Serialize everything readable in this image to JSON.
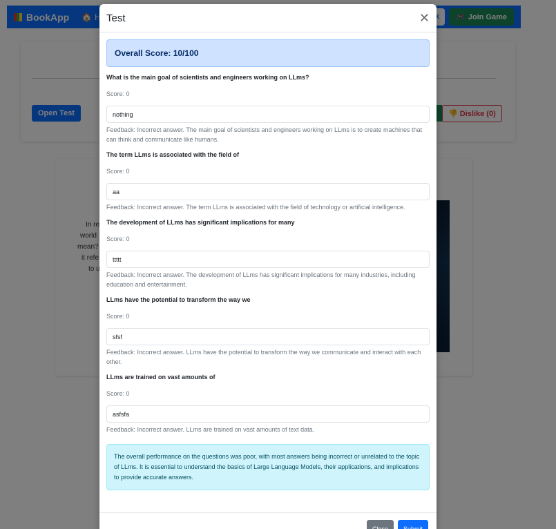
{
  "app": {
    "brand": "BookApp",
    "nav_home": "Home",
    "nav_book": "Book",
    "nav_join_game": "Join Game"
  },
  "background": {
    "open_test": "Open Test",
    "dislike": "Dislike (0)",
    "snippet_lines": [
      "In re",
      "world",
      "mean?",
      "it refe",
      "to u"
    ]
  },
  "modal": {
    "title": "Test",
    "overall_score": "Overall Score: 10/100",
    "questions": [
      {
        "question": "What is the main goal of scientists and engineers working on LLms?",
        "score": "Score: 0",
        "answer": "nothing",
        "feedback": "Feedback: Incorrect answer. The main goal of scientists and engineers working on LLms is to create machines that can think and communicate like humans."
      },
      {
        "question": "The term LLms is associated with the field of",
        "score": "Score: 0",
        "answer": "aa",
        "feedback": "Feedback: Incorrect answer. The term LLms is associated with the field of technology or artificial intelligence."
      },
      {
        "question": "The development of LLms has significant implications for many",
        "score": "Score: 0",
        "answer": "ttttt",
        "feedback": "Feedback: Incorrect answer. The development of LLms has significant implications for many industries, including education and entertainment."
      },
      {
        "question": "LLms have the potential to transform the way we",
        "score": "Score: 0",
        "answer": "sfsf",
        "feedback": "Feedback: Incorrect answer. LLms have the potential to transform the way we communicate and interact with each other."
      },
      {
        "question": "LLms are trained on vast amounts of",
        "score": "Score: 0",
        "answer": "asfsfa",
        "feedback": "Feedback: Incorrect answer. LLms are trained on vast amounts of text data."
      }
    ],
    "summary": "The overall performance on the questions was poor, with most answers being incorrect or unrelated to the topic of LLms. It is essential to understand the basics of Large Language Models, their applications, and implications to provide accurate answers.",
    "close_label": "Close",
    "submit_label": "Submit"
  }
}
